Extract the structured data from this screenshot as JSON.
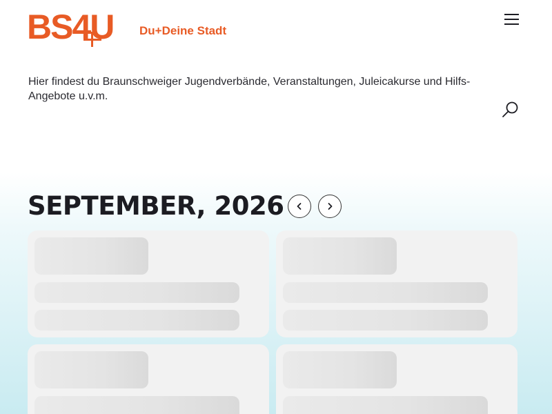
{
  "header": {
    "logo_text": "BS4U",
    "tagline": "Du+Deine Stadt",
    "menu_icon": "hamburger-menu-icon",
    "search_icon": "search-icon"
  },
  "intro": {
    "text": "Hier findest du Braunschweiger Jugendverbände, Veranstaltungen, Juleicakurse und Hilfs-Angebote u.v.m."
  },
  "calendar": {
    "month_label": "SEPTEMBER, 2026",
    "prev_icon": "chevron-left-icon",
    "next_icon": "chevron-right-icon"
  },
  "colors": {
    "brand": "#e85b25",
    "text": "#1c1c22",
    "skeleton": "#e4e4e4",
    "card": "#f2f2f2",
    "gradient_bottom": "#c9ebf1"
  }
}
